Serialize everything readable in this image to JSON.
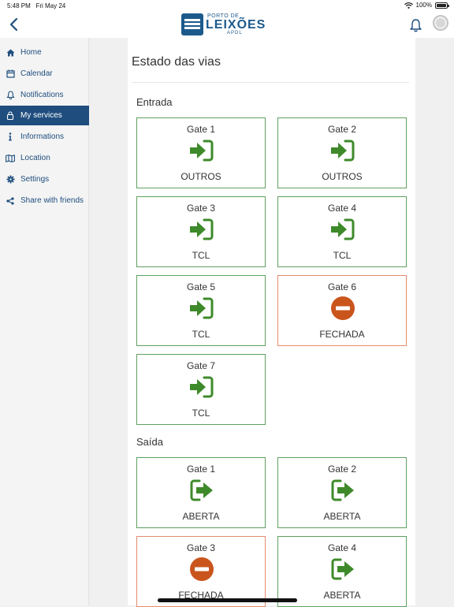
{
  "status_bar": {
    "time": "5:48 PM",
    "date": "Fri May 24",
    "battery": "100%",
    "battery_level": 1.0
  },
  "header": {
    "logo_line1": "PORTO DE",
    "logo_line2": "LEIXÕES",
    "logo_line3": "APDL"
  },
  "sidebar": {
    "items": [
      {
        "label": "Home",
        "icon": "home-icon"
      },
      {
        "label": "Calendar",
        "icon": "calendar-icon"
      },
      {
        "label": "Notifications",
        "icon": "bell-icon"
      },
      {
        "label": "My services",
        "icon": "lock-icon",
        "active": true
      },
      {
        "label": "Informations",
        "icon": "info-icon"
      },
      {
        "label": "Location",
        "icon": "map-icon"
      },
      {
        "label": "Settings",
        "icon": "gear-icon"
      },
      {
        "label": "Share with friends",
        "icon": "share-icon"
      }
    ]
  },
  "main": {
    "title": "Estado das vias",
    "sections": [
      {
        "heading": "Entrada",
        "gates": [
          {
            "name": "Gate 1",
            "status": "OUTROS",
            "state": "open"
          },
          {
            "name": "Gate 2",
            "status": "OUTROS",
            "state": "open"
          },
          {
            "name": "Gate 3",
            "status": "TCL",
            "state": "open"
          },
          {
            "name": "Gate 4",
            "status": "TCL",
            "state": "open"
          },
          {
            "name": "Gate 5",
            "status": "TCL",
            "state": "open"
          },
          {
            "name": "Gate 6",
            "status": "FECHADA",
            "state": "closed"
          },
          {
            "name": "Gate 7",
            "status": "TCL",
            "state": "open"
          }
        ]
      },
      {
        "heading": "Saída",
        "gates": [
          {
            "name": "Gate 1",
            "status": "ABERTA",
            "state": "open"
          },
          {
            "name": "Gate 2",
            "status": "ABERTA",
            "state": "open"
          },
          {
            "name": "Gate 3",
            "status": "FECHADA",
            "state": "closed"
          },
          {
            "name": "Gate 4",
            "status": "ABERTA",
            "state": "open"
          }
        ]
      }
    ]
  },
  "colors": {
    "brand": "#1f4e7e",
    "open": "#3e8a2a",
    "closed": "#c9551d"
  }
}
